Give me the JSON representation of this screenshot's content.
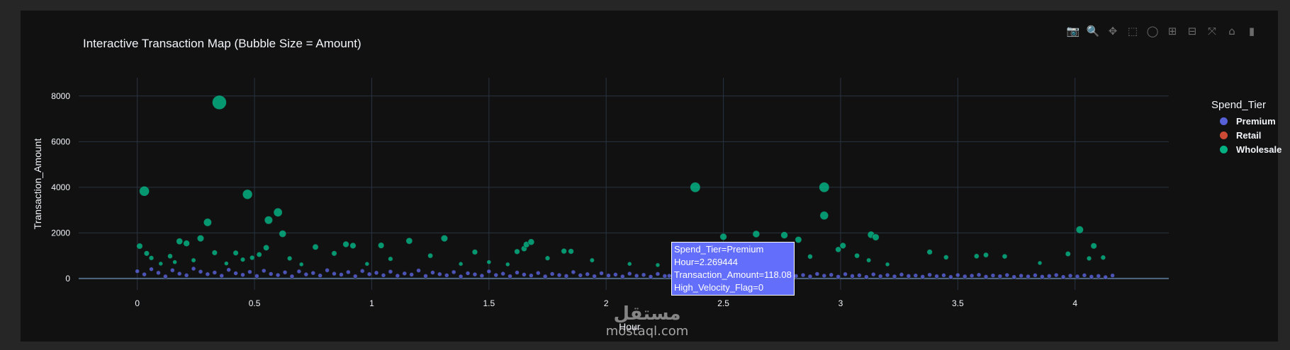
{
  "toolbar": {
    "buttons": [
      {
        "name": "camera-icon",
        "glyph": "📷",
        "active": false
      },
      {
        "name": "zoom-icon",
        "glyph": "🔍",
        "active": true
      },
      {
        "name": "pan-icon",
        "glyph": "✥",
        "active": false
      },
      {
        "name": "box-select-icon",
        "glyph": "⬚",
        "active": false
      },
      {
        "name": "lasso-select-icon",
        "glyph": "◯",
        "active": false
      },
      {
        "name": "zoom-in-icon",
        "glyph": "⊞",
        "active": false
      },
      {
        "name": "zoom-out-icon",
        "glyph": "⊟",
        "active": false
      },
      {
        "name": "autoscale-icon",
        "glyph": "⤧",
        "active": false
      },
      {
        "name": "reset-axes-icon",
        "glyph": "⌂",
        "active": false
      },
      {
        "name": "plotly-logo-icon",
        "glyph": "▮",
        "active": false
      }
    ]
  },
  "chart_data": {
    "type": "scatter",
    "title": "Interactive Transaction Map (Bubble Size = Amount)",
    "xlabel": "Hour",
    "ylabel": "Transaction_Amount",
    "xlim": [
      -0.25,
      4.4
    ],
    "ylim": [
      -500,
      8800
    ],
    "x_ticks": [
      0,
      0.5,
      1,
      1.5,
      2,
      2.5,
      3,
      3.5,
      4
    ],
    "x_tick_labels": [
      "0",
      "0.5",
      "1",
      "1.5",
      "2",
      "2.5",
      "3",
      "3.5",
      "4"
    ],
    "y_ticks": [
      0,
      2000,
      4000,
      6000,
      8000
    ],
    "y_tick_labels": [
      "0",
      "2000",
      "4000",
      "6000",
      "8000"
    ],
    "grid": true,
    "legend_title": "Spend_Tier",
    "legend_position": "right",
    "series": [
      {
        "name": "Premium",
        "color": "#636efa",
        "points": [
          [
            0.0,
            320
          ],
          [
            0.03,
            180
          ],
          [
            0.06,
            410
          ],
          [
            0.09,
            250
          ],
          [
            0.12,
            90
          ],
          [
            0.15,
            360
          ],
          [
            0.18,
            210
          ],
          [
            0.21,
            140
          ],
          [
            0.24,
            430
          ],
          [
            0.27,
            300
          ],
          [
            0.3,
            190
          ],
          [
            0.33,
            260
          ],
          [
            0.36,
            120
          ],
          [
            0.39,
            380
          ],
          [
            0.42,
            230
          ],
          [
            0.45,
            160
          ],
          [
            0.48,
            290
          ],
          [
            0.51,
            110
          ],
          [
            0.54,
            340
          ],
          [
            0.57,
            200
          ],
          [
            0.6,
            150
          ],
          [
            0.63,
            270
          ],
          [
            0.66,
            95
          ],
          [
            0.69,
            310
          ],
          [
            0.72,
            180
          ],
          [
            0.75,
            240
          ],
          [
            0.78,
            130
          ],
          [
            0.81,
            360
          ],
          [
            0.84,
            210
          ],
          [
            0.87,
            170
          ],
          [
            0.9,
            280
          ],
          [
            0.93,
            100
          ],
          [
            0.96,
            330
          ],
          [
            0.99,
            190
          ],
          [
            1.02,
            250
          ],
          [
            1.05,
            140
          ],
          [
            1.08,
            300
          ],
          [
            1.11,
            120
          ],
          [
            1.14,
            220
          ],
          [
            1.17,
            170
          ],
          [
            1.2,
            350
          ],
          [
            1.23,
            110
          ],
          [
            1.26,
            260
          ],
          [
            1.29,
            190
          ],
          [
            1.32,
            140
          ],
          [
            1.35,
            280
          ],
          [
            1.38,
            90
          ],
          [
            1.41,
            230
          ],
          [
            1.44,
            180
          ],
          [
            1.47,
            120
          ],
          [
            1.5,
            310
          ],
          [
            1.53,
            150
          ],
          [
            1.56,
            210
          ],
          [
            1.59,
            100
          ],
          [
            1.62,
            260
          ],
          [
            1.65,
            170
          ],
          [
            1.68,
            130
          ],
          [
            1.71,
            240
          ],
          [
            1.74,
            90
          ],
          [
            1.77,
            200
          ],
          [
            1.8,
            150
          ],
          [
            1.83,
            110
          ],
          [
            1.86,
            280
          ],
          [
            1.89,
            140
          ],
          [
            1.92,
            190
          ],
          [
            1.95,
            100
          ],
          [
            1.98,
            230
          ],
          [
            2.01,
            130
          ],
          [
            2.04,
            170
          ],
          [
            2.07,
            90
          ],
          [
            2.1,
            210
          ],
          [
            2.13,
            120
          ],
          [
            2.16,
            160
          ],
          [
            2.19,
            80
          ],
          [
            2.22,
            200
          ],
          [
            2.25,
            110
          ],
          [
            2.269444,
            118.08
          ],
          [
            2.3,
            150
          ],
          [
            2.33,
            90
          ],
          [
            2.36,
            190
          ],
          [
            2.39,
            120
          ],
          [
            2.42,
            70
          ],
          [
            2.45,
            170
          ],
          [
            2.48,
            100
          ],
          [
            2.51,
            140
          ],
          [
            2.54,
            80
          ],
          [
            2.57,
            190
          ],
          [
            2.6,
            110
          ],
          [
            2.63,
            150
          ],
          [
            2.66,
            90
          ],
          [
            2.69,
            210
          ],
          [
            2.72,
            130
          ],
          [
            2.75,
            80
          ],
          [
            2.78,
            180
          ],
          [
            2.81,
            110
          ],
          [
            2.84,
            150
          ],
          [
            2.87,
            90
          ],
          [
            2.9,
            200
          ],
          [
            2.93,
            120
          ],
          [
            2.96,
            160
          ],
          [
            2.99,
            80
          ],
          [
            3.02,
            190
          ],
          [
            3.05,
            110
          ],
          [
            3.08,
            140
          ],
          [
            3.11,
            70
          ],
          [
            3.14,
            180
          ],
          [
            3.17,
            100
          ],
          [
            3.2,
            150
          ],
          [
            3.23,
            90
          ],
          [
            3.26,
            170
          ],
          [
            3.29,
            110
          ],
          [
            3.32,
            130
          ],
          [
            3.35,
            80
          ],
          [
            3.38,
            160
          ],
          [
            3.41,
            100
          ],
          [
            3.44,
            140
          ],
          [
            3.47,
            70
          ],
          [
            3.5,
            150
          ],
          [
            3.53,
            90
          ],
          [
            3.56,
            120
          ],
          [
            3.59,
            160
          ],
          [
            3.62,
            80
          ],
          [
            3.65,
            130
          ],
          [
            3.68,
            100
          ],
          [
            3.71,
            150
          ],
          [
            3.74,
            70
          ],
          [
            3.77,
            120
          ],
          [
            3.8,
            90
          ],
          [
            3.83,
            140
          ],
          [
            3.86,
            80
          ],
          [
            3.89,
            110
          ],
          [
            3.92,
            150
          ],
          [
            3.95,
            70
          ],
          [
            3.98,
            120
          ],
          [
            4.01,
            90
          ],
          [
            4.04,
            140
          ],
          [
            4.07,
            80
          ],
          [
            4.1,
            110
          ],
          [
            4.13,
            60
          ],
          [
            4.16,
            130
          ]
        ]
      },
      {
        "name": "Retail",
        "color": "#ef553b",
        "points": []
      },
      {
        "name": "Wholesale",
        "color": "#00cc96",
        "points": [
          [
            0.01,
            1420
          ],
          [
            0.03,
            3830
          ],
          [
            0.04,
            1100
          ],
          [
            0.06,
            900
          ],
          [
            0.1,
            650
          ],
          [
            0.14,
            980
          ],
          [
            0.16,
            720
          ],
          [
            0.18,
            1630
          ],
          [
            0.21,
            1540
          ],
          [
            0.24,
            800
          ],
          [
            0.27,
            1760
          ],
          [
            0.3,
            2460
          ],
          [
            0.33,
            1130
          ],
          [
            0.35,
            7720
          ],
          [
            0.38,
            660
          ],
          [
            0.42,
            1120
          ],
          [
            0.45,
            830
          ],
          [
            0.47,
            3690
          ],
          [
            0.49,
            910
          ],
          [
            0.52,
            1050
          ],
          [
            0.55,
            1350
          ],
          [
            0.56,
            2560
          ],
          [
            0.6,
            2900
          ],
          [
            0.62,
            1960
          ],
          [
            0.65,
            880
          ],
          [
            0.7,
            620
          ],
          [
            0.76,
            1380
          ],
          [
            0.84,
            1100
          ],
          [
            0.89,
            1500
          ],
          [
            0.92,
            1440
          ],
          [
            0.98,
            640
          ],
          [
            1.04,
            1450
          ],
          [
            1.08,
            860
          ],
          [
            1.16,
            1650
          ],
          [
            1.25,
            1000
          ],
          [
            1.31,
            1760
          ],
          [
            1.38,
            640
          ],
          [
            1.44,
            1160
          ],
          [
            1.5,
            720
          ],
          [
            1.58,
            620
          ],
          [
            1.62,
            1180
          ],
          [
            1.65,
            1310
          ],
          [
            1.66,
            1490
          ],
          [
            1.68,
            1600
          ],
          [
            1.75,
            890
          ],
          [
            1.82,
            1200
          ],
          [
            1.85,
            1190
          ],
          [
            1.94,
            800
          ],
          [
            2.1,
            640
          ],
          [
            2.22,
            590
          ],
          [
            2.38,
            4000
          ],
          [
            2.5,
            1830
          ],
          [
            2.64,
            1950
          ],
          [
            2.76,
            1900
          ],
          [
            2.82,
            1700
          ],
          [
            2.87,
            960
          ],
          [
            2.93,
            4000
          ],
          [
            2.93,
            2760
          ],
          [
            2.99,
            1270
          ],
          [
            3.01,
            1440
          ],
          [
            3.07,
            1000
          ],
          [
            3.12,
            800
          ],
          [
            3.13,
            1920
          ],
          [
            3.15,
            1810
          ],
          [
            3.2,
            620
          ],
          [
            3.38,
            1160
          ],
          [
            3.45,
            930
          ],
          [
            3.58,
            980
          ],
          [
            3.62,
            1030
          ],
          [
            3.7,
            970
          ],
          [
            3.85,
            680
          ],
          [
            3.97,
            1080
          ],
          [
            4.02,
            2140
          ],
          [
            4.06,
            880
          ],
          [
            4.08,
            1430
          ],
          [
            4.12,
            920
          ]
        ]
      }
    ]
  },
  "tooltip": {
    "line1": "Spend_Tier=Premium",
    "line2": "Hour=2.269444",
    "line3": "Transaction_Amount=118.08",
    "line4": "High_Velocity_Flag=0"
  },
  "watermark": {
    "arabic": "مستقل",
    "domain": "mostaql.com"
  }
}
